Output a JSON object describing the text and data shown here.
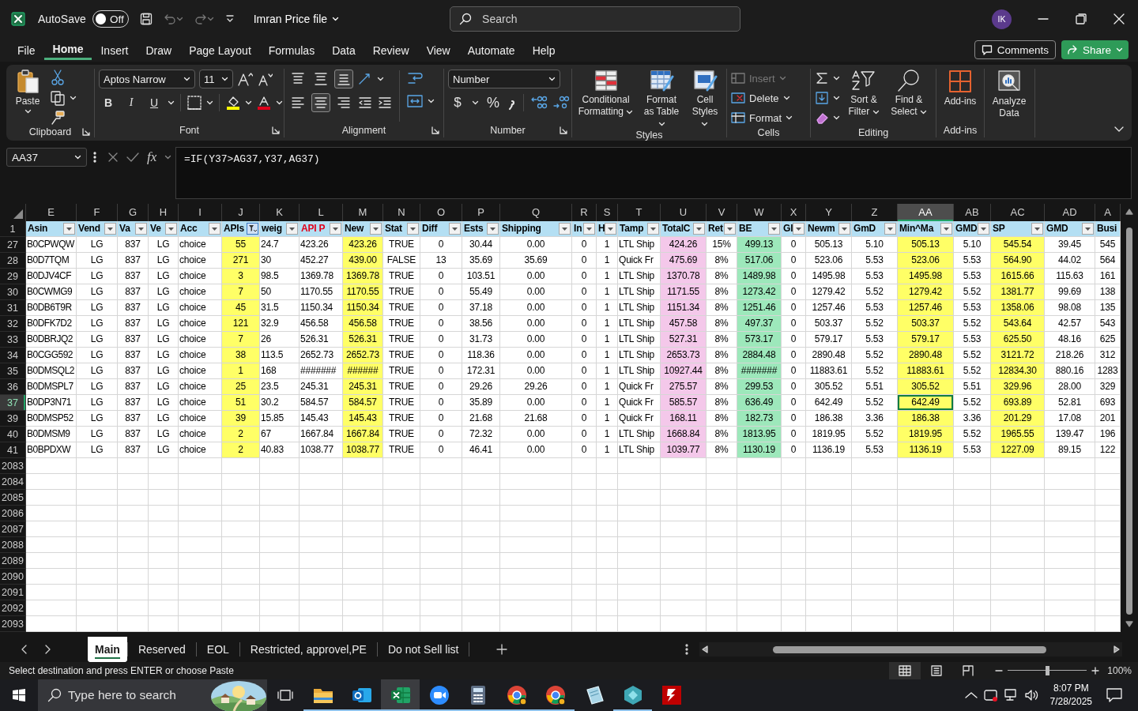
{
  "window": {
    "title": "Imran Price file",
    "autosave_label": "AutoSave",
    "autosave": {
      "on": false,
      "label": "Off"
    },
    "search_placeholder": "Search",
    "account_initials": "IK"
  },
  "menu_tabs": [
    {
      "label": "File",
      "selected": false
    },
    {
      "label": "Home",
      "selected": true
    },
    {
      "label": "Insert",
      "selected": false
    },
    {
      "label": "Draw",
      "selected": false
    },
    {
      "label": "Page Layout",
      "selected": false
    },
    {
      "label": "Formulas",
      "selected": false
    },
    {
      "label": "Data",
      "selected": false
    },
    {
      "label": "Review",
      "selected": false
    },
    {
      "label": "View",
      "selected": false
    },
    {
      "label": "Automate",
      "selected": false
    },
    {
      "label": "Help",
      "selected": false
    }
  ],
  "comments_button": "Comments",
  "share_button": "Share",
  "ribbon": {
    "clipboard": {
      "label": "Clipboard",
      "paste": "Paste"
    },
    "font": {
      "label": "Font",
      "family": "Aptos Narrow",
      "size": "11",
      "styles": [
        "B",
        "I",
        "U"
      ]
    },
    "alignment": {
      "label": "Alignment",
      "vertical": [
        {
          "selected": false
        },
        {
          "selected": false
        },
        {
          "selected": true
        }
      ],
      "horizontal": [
        {
          "selected": false
        },
        {
          "selected": true
        },
        {
          "selected": false
        }
      ]
    },
    "number": {
      "label": "Number",
      "format": "Number",
      "symbols": [
        "$",
        "%"
      ]
    },
    "styles": {
      "label": "Styles",
      "buttons": [
        "Conditional Formatting",
        "Format as Table",
        "Cell Styles"
      ]
    },
    "cells": {
      "label": "Cells",
      "buttons": [
        {
          "label": "Insert",
          "disabled": true
        },
        {
          "label": "Delete",
          "disabled": false
        },
        {
          "label": "Format",
          "disabled": false
        }
      ]
    },
    "editing": {
      "label": "Editing",
      "buttons": [
        "Sort & Filter",
        "Find & Select"
      ]
    },
    "addins": {
      "label": "Add-ins",
      "button": "Add-ins"
    },
    "analyze": {
      "button": "Analyze Data"
    }
  },
  "formula_bar": {
    "name_box": "AA37",
    "function_label": "fx",
    "formula": "=IF(Y37>AG37,Y37,AG37)"
  },
  "sheet": {
    "header_row_number": "1",
    "columns": [
      {
        "letter": "E",
        "header": "Asin",
        "kind": "plain",
        "has_filter": true,
        "filtered": false,
        "selected": false
      },
      {
        "letter": "F",
        "header": "Vend",
        "kind": "plain",
        "has_filter": true,
        "filtered": false,
        "selected": false
      },
      {
        "letter": "G",
        "header": "Va",
        "kind": "plain",
        "has_filter": true,
        "filtered": false,
        "selected": false
      },
      {
        "letter": "H",
        "header": "Ve",
        "kind": "plain",
        "has_filter": true,
        "filtered": false,
        "selected": false
      },
      {
        "letter": "I",
        "header": "Acc",
        "kind": "plain",
        "has_filter": true,
        "filtered": false,
        "selected": false
      },
      {
        "letter": "J",
        "header": "APIs",
        "kind": "plain",
        "has_filter": true,
        "filtered": true,
        "selected": false,
        "color": "#ffff66"
      },
      {
        "letter": "K",
        "header": "weig",
        "kind": "plain",
        "has_filter": true,
        "filtered": false,
        "selected": false
      },
      {
        "letter": "L",
        "header": "API P",
        "kind": "alert",
        "has_filter": true,
        "filtered": false,
        "selected": false
      },
      {
        "letter": "M",
        "header": "New",
        "kind": "plain",
        "has_filter": true,
        "filtered": false,
        "selected": false,
        "color": "#ffff66"
      },
      {
        "letter": "N",
        "header": "Stat",
        "kind": "plain",
        "has_filter": true,
        "filtered": false,
        "selected": false
      },
      {
        "letter": "O",
        "header": "Diff",
        "kind": "plain",
        "has_filter": true,
        "filtered": false,
        "selected": false
      },
      {
        "letter": "P",
        "header": "Ests",
        "kind": "plain",
        "has_filter": true,
        "filtered": false,
        "selected": false
      },
      {
        "letter": "Q",
        "header": "Shipping",
        "kind": "plain",
        "has_filter": true,
        "filtered": false,
        "selected": false
      },
      {
        "letter": "R",
        "header": "In",
        "kind": "plain",
        "has_filter": true,
        "filtered": false,
        "selected": false
      },
      {
        "letter": "S",
        "header": "H",
        "kind": "plain",
        "has_filter": true,
        "filtered": false,
        "selected": false
      },
      {
        "letter": "T",
        "header": "Tamp",
        "kind": "plain",
        "has_filter": true,
        "filtered": false,
        "selected": false
      },
      {
        "letter": "U",
        "header": "TotalC",
        "kind": "plain",
        "has_filter": true,
        "filtered": false,
        "selected": false,
        "color": "#f4c8ea"
      },
      {
        "letter": "V",
        "header": "Ret",
        "kind": "plain",
        "has_filter": true,
        "filtered": false,
        "selected": false
      },
      {
        "letter": "W",
        "header": "BE",
        "kind": "plain",
        "has_filter": true,
        "filtered": false,
        "selected": false,
        "color": "#9de8bb"
      },
      {
        "letter": "X",
        "header": "Gl",
        "kind": "plain",
        "has_filter": true,
        "filtered": false,
        "selected": false
      },
      {
        "letter": "Y",
        "header": "Newm",
        "kind": "plain",
        "has_filter": true,
        "filtered": false,
        "selected": false
      },
      {
        "letter": "Z",
        "header": "GmD",
        "kind": "plain",
        "has_filter": true,
        "filtered": false,
        "selected": false
      },
      {
        "letter": "AA",
        "header": "Min^Ma",
        "kind": "plain",
        "has_filter": true,
        "filtered": false,
        "selected": true,
        "color": "#ffff66"
      },
      {
        "letter": "AB",
        "header": "GMD",
        "kind": "plain",
        "has_filter": true,
        "filtered": false,
        "selected": false
      },
      {
        "letter": "AC",
        "header": "SP",
        "kind": "plain",
        "has_filter": true,
        "filtered": false,
        "selected": false,
        "color": "#ffff66"
      },
      {
        "letter": "AD",
        "header": "GMD",
        "kind": "plain",
        "has_filter": true,
        "filtered": false,
        "selected": false
      },
      {
        "letter": "A",
        "header": "Busi",
        "kind": "plain",
        "has_filter": false,
        "filtered": false,
        "selected": false
      }
    ],
    "rows": [
      {
        "number": "27",
        "selected": false,
        "cells": [
          "B0CPWQW",
          "LG",
          "837",
          "LG",
          "choice",
          "55",
          "24.7",
          "423.26",
          "423.26",
          "TRUE",
          "0",
          "30.44",
          "0.00",
          "0",
          "1",
          "LTL Ship",
          "424.26",
          "15%",
          "499.13",
          "0",
          "505.13",
          "5.10",
          "505.13",
          "5.10",
          "545.54",
          "39.45",
          "545"
        ]
      },
      {
        "number": "28",
        "selected": false,
        "cells": [
          "B0D7TQM",
          "LG",
          "837",
          "LG",
          "choice",
          "271",
          "30",
          "452.27",
          "439.00",
          "FALSE",
          "13",
          "35.69",
          "35.69",
          "0",
          "1",
          "Quick Fr",
          "475.69",
          "8%",
          "517.06",
          "0",
          "523.06",
          "5.53",
          "523.06",
          "5.53",
          "564.90",
          "44.02",
          "564"
        ]
      },
      {
        "number": "29",
        "selected": false,
        "cells": [
          "B0DJV4CF",
          "LG",
          "837",
          "LG",
          "choice",
          "3",
          "98.5",
          "1369.78",
          "1369.78",
          "TRUE",
          "0",
          "103.51",
          "0.00",
          "0",
          "1",
          "LTL Ship",
          "1370.78",
          "8%",
          "1489.98",
          "0",
          "1495.98",
          "5.53",
          "1495.98",
          "5.53",
          "1615.66",
          "115.63",
          "161"
        ]
      },
      {
        "number": "30",
        "selected": false,
        "cells": [
          "B0CWMG9",
          "LG",
          "837",
          "LG",
          "choice",
          "7",
          "50",
          "1170.55",
          "1170.55",
          "TRUE",
          "0",
          "55.49",
          "0.00",
          "0",
          "1",
          "LTL Ship",
          "1171.55",
          "8%",
          "1273.42",
          "0",
          "1279.42",
          "5.52",
          "1279.42",
          "5.52",
          "1381.77",
          "99.69",
          "138"
        ]
      },
      {
        "number": "31",
        "selected": false,
        "cells": [
          "B0DB6T9R",
          "LG",
          "837",
          "LG",
          "choice",
          "45",
          "31.5",
          "1150.34",
          "1150.34",
          "TRUE",
          "0",
          "37.18",
          "0.00",
          "0",
          "1",
          "LTL Ship",
          "1151.34",
          "8%",
          "1251.46",
          "0",
          "1257.46",
          "5.53",
          "1257.46",
          "5.53",
          "1358.06",
          "98.08",
          "135"
        ]
      },
      {
        "number": "32",
        "selected": false,
        "cells": [
          "B0DFK7D2",
          "LG",
          "837",
          "LG",
          "choice",
          "121",
          "32.9",
          "456.58",
          "456.58",
          "TRUE",
          "0",
          "38.56",
          "0.00",
          "0",
          "1",
          "LTL Ship",
          "457.58",
          "8%",
          "497.37",
          "0",
          "503.37",
          "5.52",
          "503.37",
          "5.52",
          "543.64",
          "42.57",
          "543"
        ]
      },
      {
        "number": "33",
        "selected": false,
        "cells": [
          "B0DBRJQ2",
          "LG",
          "837",
          "LG",
          "choice",
          "7",
          "26",
          "526.31",
          "526.31",
          "TRUE",
          "0",
          "31.73",
          "0.00",
          "0",
          "1",
          "LTL Ship",
          "527.31",
          "8%",
          "573.17",
          "0",
          "579.17",
          "5.53",
          "579.17",
          "5.53",
          "625.50",
          "48.16",
          "625"
        ]
      },
      {
        "number": "34",
        "selected": false,
        "cells": [
          "B0CGG592",
          "LG",
          "837",
          "LG",
          "choice",
          "38",
          "113.5",
          "2652.73",
          "2652.73",
          "TRUE",
          "0",
          "118.36",
          "0.00",
          "0",
          "1",
          "LTL Ship",
          "2653.73",
          "8%",
          "2884.48",
          "0",
          "2890.48",
          "5.52",
          "2890.48",
          "5.52",
          "3121.72",
          "218.26",
          "312"
        ]
      },
      {
        "number": "35",
        "selected": false,
        "cells": [
          "B0DMSQL2",
          "LG",
          "837",
          "LG",
          "choice",
          "1",
          "168",
          "#######",
          "######",
          "TRUE",
          "0",
          "172.31",
          "0.00",
          "0",
          "1",
          "LTL Ship",
          "10927.44",
          "8%",
          "#######",
          "0",
          "11883.61",
          "5.52",
          "11883.61",
          "5.52",
          "12834.30",
          "880.16",
          "1283"
        ]
      },
      {
        "number": "36",
        "selected": false,
        "cells": [
          "B0DMSPL7",
          "LG",
          "837",
          "LG",
          "choice",
          "25",
          "23.5",
          "245.31",
          "245.31",
          "TRUE",
          "0",
          "29.26",
          "29.26",
          "0",
          "1",
          "Quick Fr",
          "275.57",
          "8%",
          "299.53",
          "0",
          "305.52",
          "5.51",
          "305.52",
          "5.51",
          "329.96",
          "28.00",
          "329"
        ]
      },
      {
        "number": "37",
        "selected": true,
        "cells": [
          "B0DP3N71",
          "LG",
          "837",
          "LG",
          "choice",
          "51",
          "30.2",
          "584.57",
          "584.57",
          "TRUE",
          "0",
          "35.89",
          "0.00",
          "0",
          "1",
          "Quick Fr",
          "585.57",
          "8%",
          "636.49",
          "0",
          "642.49",
          "5.52",
          "642.49",
          "5.52",
          "693.89",
          "52.81",
          "693"
        ]
      },
      {
        "number": "39",
        "selected": false,
        "cells": [
          "B0DMSP52",
          "LG",
          "837",
          "LG",
          "choice",
          "39",
          "15.85",
          "145.43",
          "145.43",
          "TRUE",
          "0",
          "21.68",
          "21.68",
          "0",
          "1",
          "Quick Fr",
          "168.11",
          "8%",
          "182.73",
          "0",
          "186.38",
          "3.36",
          "186.38",
          "3.36",
          "201.29",
          "17.08",
          "201"
        ]
      },
      {
        "number": "40",
        "selected": false,
        "cells": [
          "B0DMSM9",
          "LG",
          "837",
          "LG",
          "choice",
          "2",
          "67",
          "1667.84",
          "1667.84",
          "TRUE",
          "0",
          "72.32",
          "0.00",
          "0",
          "1",
          "LTL Ship",
          "1668.84",
          "8%",
          "1813.95",
          "0",
          "1819.95",
          "5.52",
          "1819.95",
          "5.52",
          "1965.55",
          "139.47",
          "196"
        ]
      },
      {
        "number": "41",
        "selected": false,
        "cells": [
          "B0BPDXW",
          "LG",
          "837",
          "LG",
          "choice",
          "2",
          "40.83",
          "1038.77",
          "1038.77",
          "TRUE",
          "0",
          "46.41",
          "0.00",
          "0",
          "1",
          "LTL Ship",
          "1039.77",
          "8%",
          "1130.19",
          "0",
          "1136.19",
          "5.53",
          "1136.19",
          "5.53",
          "1227.09",
          "89.15",
          "122"
        ]
      },
      {
        "number": "2083",
        "selected": false
      },
      {
        "number": "2084",
        "selected": false
      },
      {
        "number": "2085",
        "selected": false
      },
      {
        "number": "2086",
        "selected": false
      },
      {
        "number": "2087",
        "selected": false
      },
      {
        "number": "2088",
        "selected": false
      },
      {
        "number": "2089",
        "selected": false
      },
      {
        "number": "2090",
        "selected": false
      },
      {
        "number": "2091",
        "selected": false
      },
      {
        "number": "2092",
        "selected": false
      },
      {
        "number": "2093",
        "selected": false
      }
    ]
  },
  "sheet_tabs": [
    {
      "label": "Main",
      "selected": true
    },
    {
      "label": "Reserved",
      "selected": false
    },
    {
      "label": "EOL",
      "selected": false
    },
    {
      "label": "Restricted, approvel,PE",
      "selected": false
    },
    {
      "label": "Do not Sell list",
      "selected": false
    }
  ],
  "status_bar": {
    "message": "Select destination and press ENTER or choose Paste",
    "views": [
      {
        "selected": true
      },
      {
        "selected": false
      },
      {
        "selected": false
      }
    ],
    "zoom": {
      "label": "100%",
      "level": 0.5
    }
  },
  "taskbar": {
    "search_placeholder": "Type here to search",
    "time": "8:07 PM",
    "date": "7/28/2025",
    "apps": [
      {
        "kind": "folder",
        "running": true,
        "selected": false
      },
      {
        "kind": "mail",
        "running": true,
        "selected": false
      },
      {
        "kind": "sheet",
        "running": true,
        "selected": true
      },
      {
        "kind": "video",
        "running": true,
        "selected": false
      },
      {
        "kind": "calculator",
        "running": true,
        "selected": false
      },
      {
        "kind": "browser",
        "running": true,
        "selected": false
      },
      {
        "kind": "browser",
        "running": true,
        "selected": false
      },
      {
        "kind": "notepad",
        "running": false,
        "selected": false
      },
      {
        "kind": "cube",
        "running": true,
        "selected": false
      },
      {
        "kind": "bolt",
        "running": false,
        "selected": false
      }
    ]
  }
}
